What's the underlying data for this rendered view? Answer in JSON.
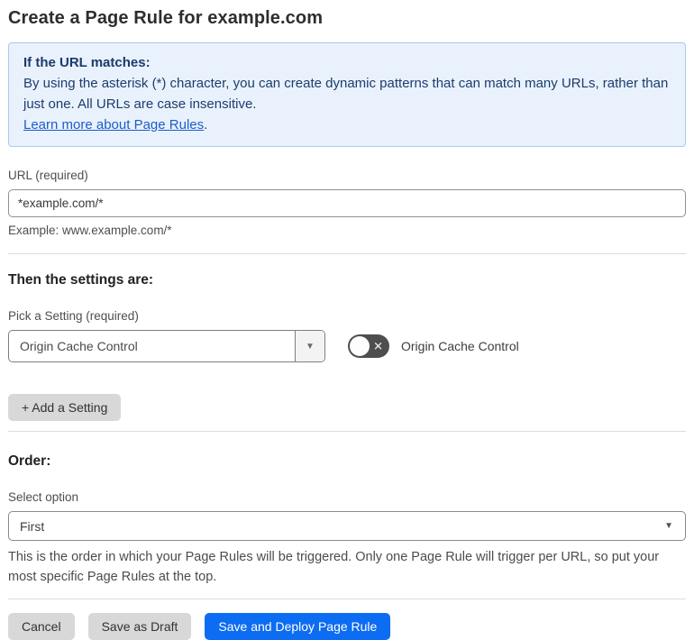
{
  "page": {
    "title": "Create a Page Rule for example.com"
  },
  "info_box": {
    "heading": "If the URL matches:",
    "body": "By using the asterisk (*) character, you can create dynamic patterns that can match many URLs, rather than just one. All URLs are case insensitive.",
    "link_text": "Learn more about Page Rules",
    "link_suffix": "."
  },
  "url_field": {
    "label": "URL (required)",
    "value": "*example.com/*",
    "helper": "Example: www.example.com/*"
  },
  "settings_section": {
    "heading": "Then the settings are:",
    "picker_label": "Pick a Setting (required)",
    "picker_value": "Origin Cache Control",
    "toggle_label": "Origin Cache Control",
    "toggle_state": "off",
    "add_setting_label": "+ Add a Setting"
  },
  "order_section": {
    "heading": "Order:",
    "select_label": "Select option",
    "select_value": "First",
    "helper": "This is the order in which your Page Rules will be triggered. Only one Page Rule will trigger per URL, so put your most specific Page Rules at the top."
  },
  "footer": {
    "cancel_label": "Cancel",
    "save_draft_label": "Save as Draft",
    "save_deploy_label": "Save and Deploy Page Rule"
  },
  "icons": {
    "toggle_x": "✕",
    "caret_down": "▼"
  },
  "colors": {
    "info_bg": "#e9f2fc",
    "info_border": "#abc9ec",
    "info_text": "#1d3c6e",
    "link_blue": "#1d5cc8",
    "primary_blue": "#0c6cf2",
    "toggle_off_bg": "#4e4e4e",
    "button_gray": "#d8d8d8"
  }
}
